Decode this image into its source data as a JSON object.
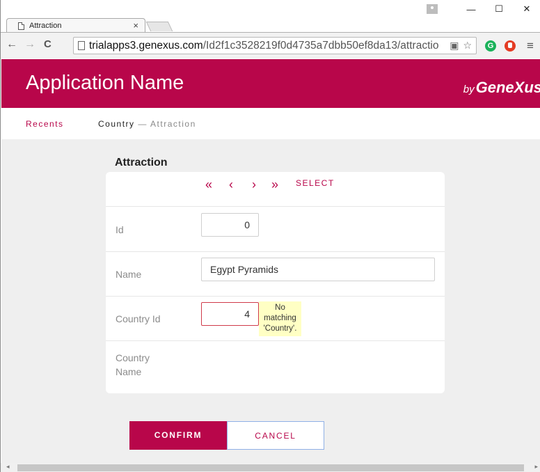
{
  "browser": {
    "tab_title": "Attraction",
    "tab_close": "×",
    "minimize": "—",
    "maximize": "☐",
    "close": "✕",
    "back": "←",
    "forward": "→",
    "reload": "C",
    "url_host": "trialapps3.genexus.com",
    "url_path": "/Id2f1c3528219f0d4735a7dbb50ef8da13/attractio",
    "star": "☆",
    "g_label": "G",
    "menu": "≡"
  },
  "app": {
    "title": "Application Name",
    "brand_by": "by",
    "brand_name": "GeneXus",
    "accent": "#b8064a"
  },
  "nav": {
    "recents": "Recents",
    "crumb_parent": "Country",
    "crumb_sep": " — ",
    "crumb_current": "Attraction"
  },
  "form": {
    "title": "Attraction",
    "first": "«",
    "prev": "‹",
    "next": "›",
    "last": "»",
    "select": "SELECT",
    "fields": {
      "id_label": "Id",
      "id_value": "0",
      "name_label": "Name",
      "name_value": "Egypt Pyramids",
      "country_id_label": "Country Id",
      "country_id_value": "4",
      "country_name_label_1": "Country",
      "country_name_label_2": "Name"
    },
    "error_line1": "No",
    "error_line2": "matching",
    "error_line3": "'Country'."
  },
  "actions": {
    "confirm": "CONFIRM",
    "cancel": "CANCEL"
  },
  "scroll": {
    "left": "◂",
    "right": "▸"
  }
}
